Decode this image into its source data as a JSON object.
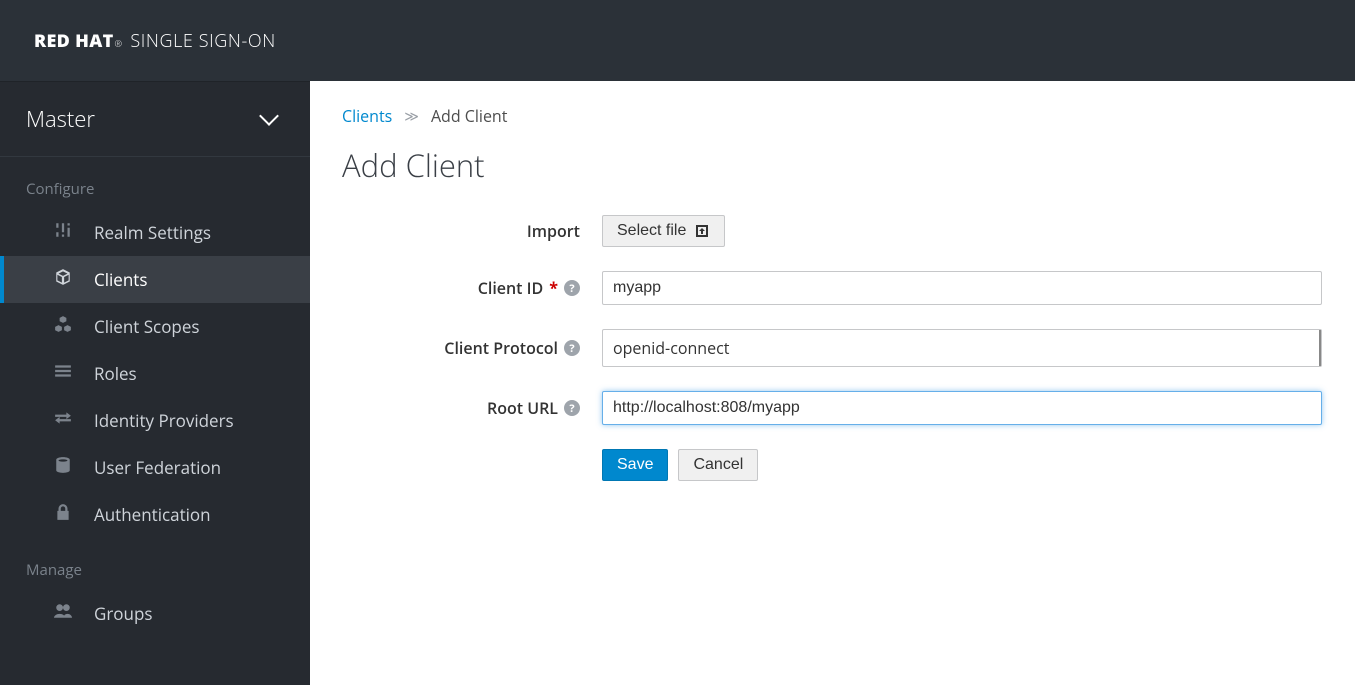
{
  "brand": {
    "bold": "RED HAT",
    "prod": "SINGLE SIGN-ON"
  },
  "realm": {
    "name": "Master"
  },
  "sidebar": {
    "configure_label": "Configure",
    "manage_label": "Manage",
    "items": [
      {
        "label": "Realm Settings"
      },
      {
        "label": "Clients"
      },
      {
        "label": "Client Scopes"
      },
      {
        "label": "Roles"
      },
      {
        "label": "Identity Providers"
      },
      {
        "label": "User Federation"
      },
      {
        "label": "Authentication"
      }
    ],
    "manage_items": [
      {
        "label": "Groups"
      }
    ]
  },
  "breadcrumb": {
    "parent": "Clients",
    "current": "Add Client"
  },
  "page": {
    "title": "Add Client"
  },
  "form": {
    "import_label": "Import",
    "select_file_label": "Select file",
    "client_id_label": "Client ID",
    "client_id_value": "myapp",
    "client_protocol_label": "Client Protocol",
    "client_protocol_value": "openid-connect",
    "root_url_label": "Root URL",
    "root_url_value": "http://localhost:808/myapp",
    "save_label": "Save",
    "cancel_label": "Cancel"
  }
}
